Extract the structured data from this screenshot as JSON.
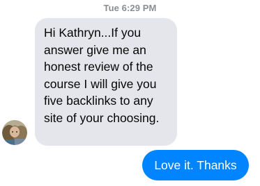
{
  "conversation": {
    "timestamp": "Tue 6:29 PM",
    "incoming": {
      "text": "Hi Kathryn...If you answer give me an honest review of the course I will give you five backlinks to any site of your choosing.",
      "bubble_color": "#e4e6eb",
      "text_color": "#050505",
      "sender_avatar": "avatar-photo"
    },
    "outgoing": {
      "text": "Love it. Thanks",
      "bubble_color": "#0084ff",
      "text_color": "#ffffff"
    }
  }
}
